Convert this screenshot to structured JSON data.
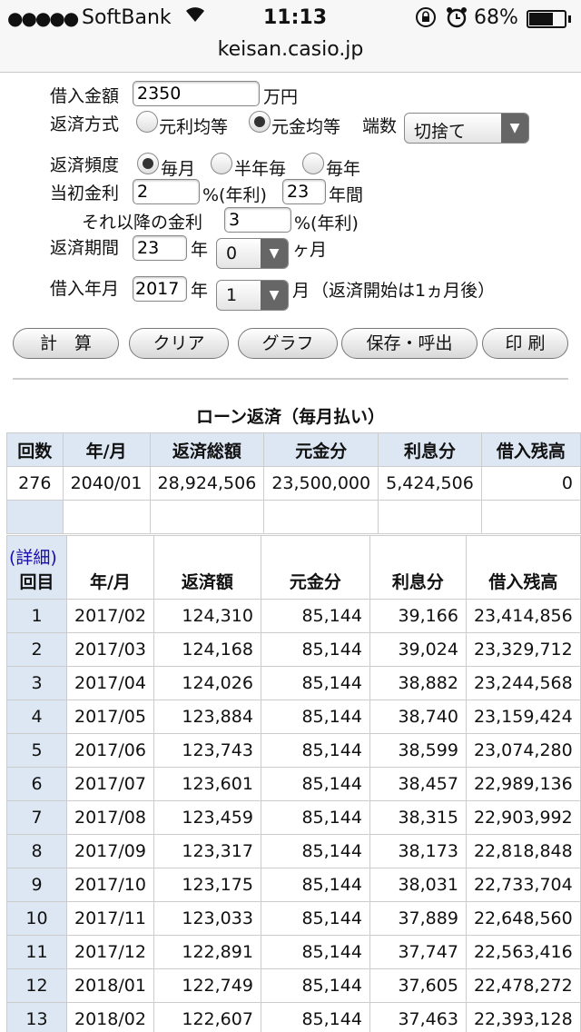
{
  "status_bar": {
    "signal": "●●●●●",
    "carrier": "SoftBank",
    "time": "11:13",
    "battery_pct": "68%",
    "battery_level": 0.68
  },
  "url": "keisan.casio.jp",
  "form": {
    "amount_label": "借入金額",
    "amount_value": "2350",
    "amount_unit": "万円",
    "method_label": "返済方式",
    "method_opt1": "元利均等",
    "method_opt2": "元金均等",
    "rounding_label": "端数",
    "rounding_value": "切捨て",
    "freq_label": "返済頻度",
    "freq_opt1": "毎月",
    "freq_opt2": "半年毎",
    "freq_opt3": "毎年",
    "rate_label": "当初金利",
    "rate_value": "2",
    "rate_unit": "%(年利)",
    "rate_years_value": "23",
    "rate_years_unit": "年間",
    "later_rate_label": "それ以降の金利",
    "later_rate_value": "3",
    "later_rate_unit": "%(年利)",
    "period_label": "返済期間",
    "period_years_value": "23",
    "period_years_unit": "年",
    "period_months_value": "0",
    "period_months_unit": "ヶ月",
    "start_label": "借入年月",
    "start_year_value": "2017",
    "start_year_unit": "年",
    "start_month_value": "1",
    "start_month_unit": "月",
    "start_note": "（返済開始は1ヵ月後）"
  },
  "buttons": {
    "calc": "計　算",
    "clear": "クリア",
    "graph": "グラフ",
    "save": "保存・呼出",
    "print": "印 刷"
  },
  "table_title": "ローン返済（毎月払い）",
  "summary": {
    "headers": [
      "回数",
      "年/月",
      "返済総額",
      "元金分",
      "利息分",
      "借入残高"
    ],
    "row": [
      "276",
      "2040/01",
      "28,924,506",
      "23,500,000",
      "5,424,506",
      "0"
    ]
  },
  "detail": {
    "link": "(詳細)",
    "headers": [
      "回目",
      "年/月",
      "返済額",
      "元金分",
      "利息分",
      "借入残高"
    ],
    "rows": [
      [
        "1",
        "2017/02",
        "124,310",
        "85,144",
        "39,166",
        "23,414,856"
      ],
      [
        "2",
        "2017/03",
        "124,168",
        "85,144",
        "39,024",
        "23,329,712"
      ],
      [
        "3",
        "2017/04",
        "124,026",
        "85,144",
        "38,882",
        "23,244,568"
      ],
      [
        "4",
        "2017/05",
        "123,884",
        "85,144",
        "38,740",
        "23,159,424"
      ],
      [
        "5",
        "2017/06",
        "123,743",
        "85,144",
        "38,599",
        "23,074,280"
      ],
      [
        "6",
        "2017/07",
        "123,601",
        "85,144",
        "38,457",
        "22,989,136"
      ],
      [
        "7",
        "2017/08",
        "123,459",
        "85,144",
        "38,315",
        "22,903,992"
      ],
      [
        "8",
        "2017/09",
        "123,317",
        "85,144",
        "38,173",
        "22,818,848"
      ],
      [
        "9",
        "2017/10",
        "123,175",
        "85,144",
        "38,031",
        "22,733,704"
      ],
      [
        "10",
        "2017/11",
        "123,033",
        "85,144",
        "37,889",
        "22,648,560"
      ],
      [
        "11",
        "2017/12",
        "122,891",
        "85,144",
        "37,747",
        "22,563,416"
      ],
      [
        "12",
        "2018/01",
        "122,749",
        "85,144",
        "37,605",
        "22,478,272"
      ],
      [
        "13",
        "2018/02",
        "122,607",
        "85,144",
        "37,463",
        "22,393,128"
      ]
    ]
  }
}
